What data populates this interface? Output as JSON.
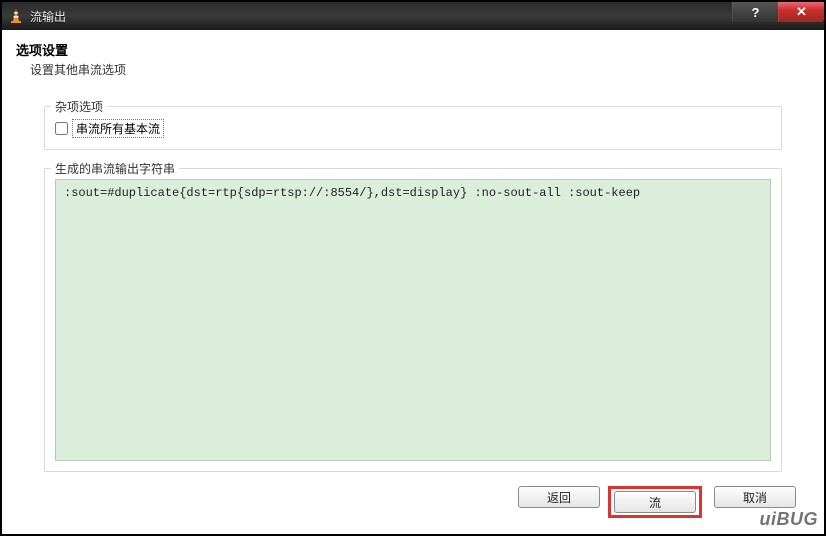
{
  "window": {
    "title": "流输出"
  },
  "header": {
    "title": "选项设置",
    "subtitle": "设置其他串流选项"
  },
  "misc_group": {
    "legend": "杂项选项",
    "stream_all_es": {
      "label": "串流所有基本流",
      "checked": false
    }
  },
  "output_group": {
    "legend": "生成的串流输出字符串",
    "value": ":sout=#duplicate{dst=rtp{sdp=rtsp://:8554/},dst=display} :no-sout-all :sout-keep"
  },
  "buttons": {
    "back": "返回",
    "stream": "流",
    "cancel": "取消"
  },
  "watermark": "uiBUG"
}
